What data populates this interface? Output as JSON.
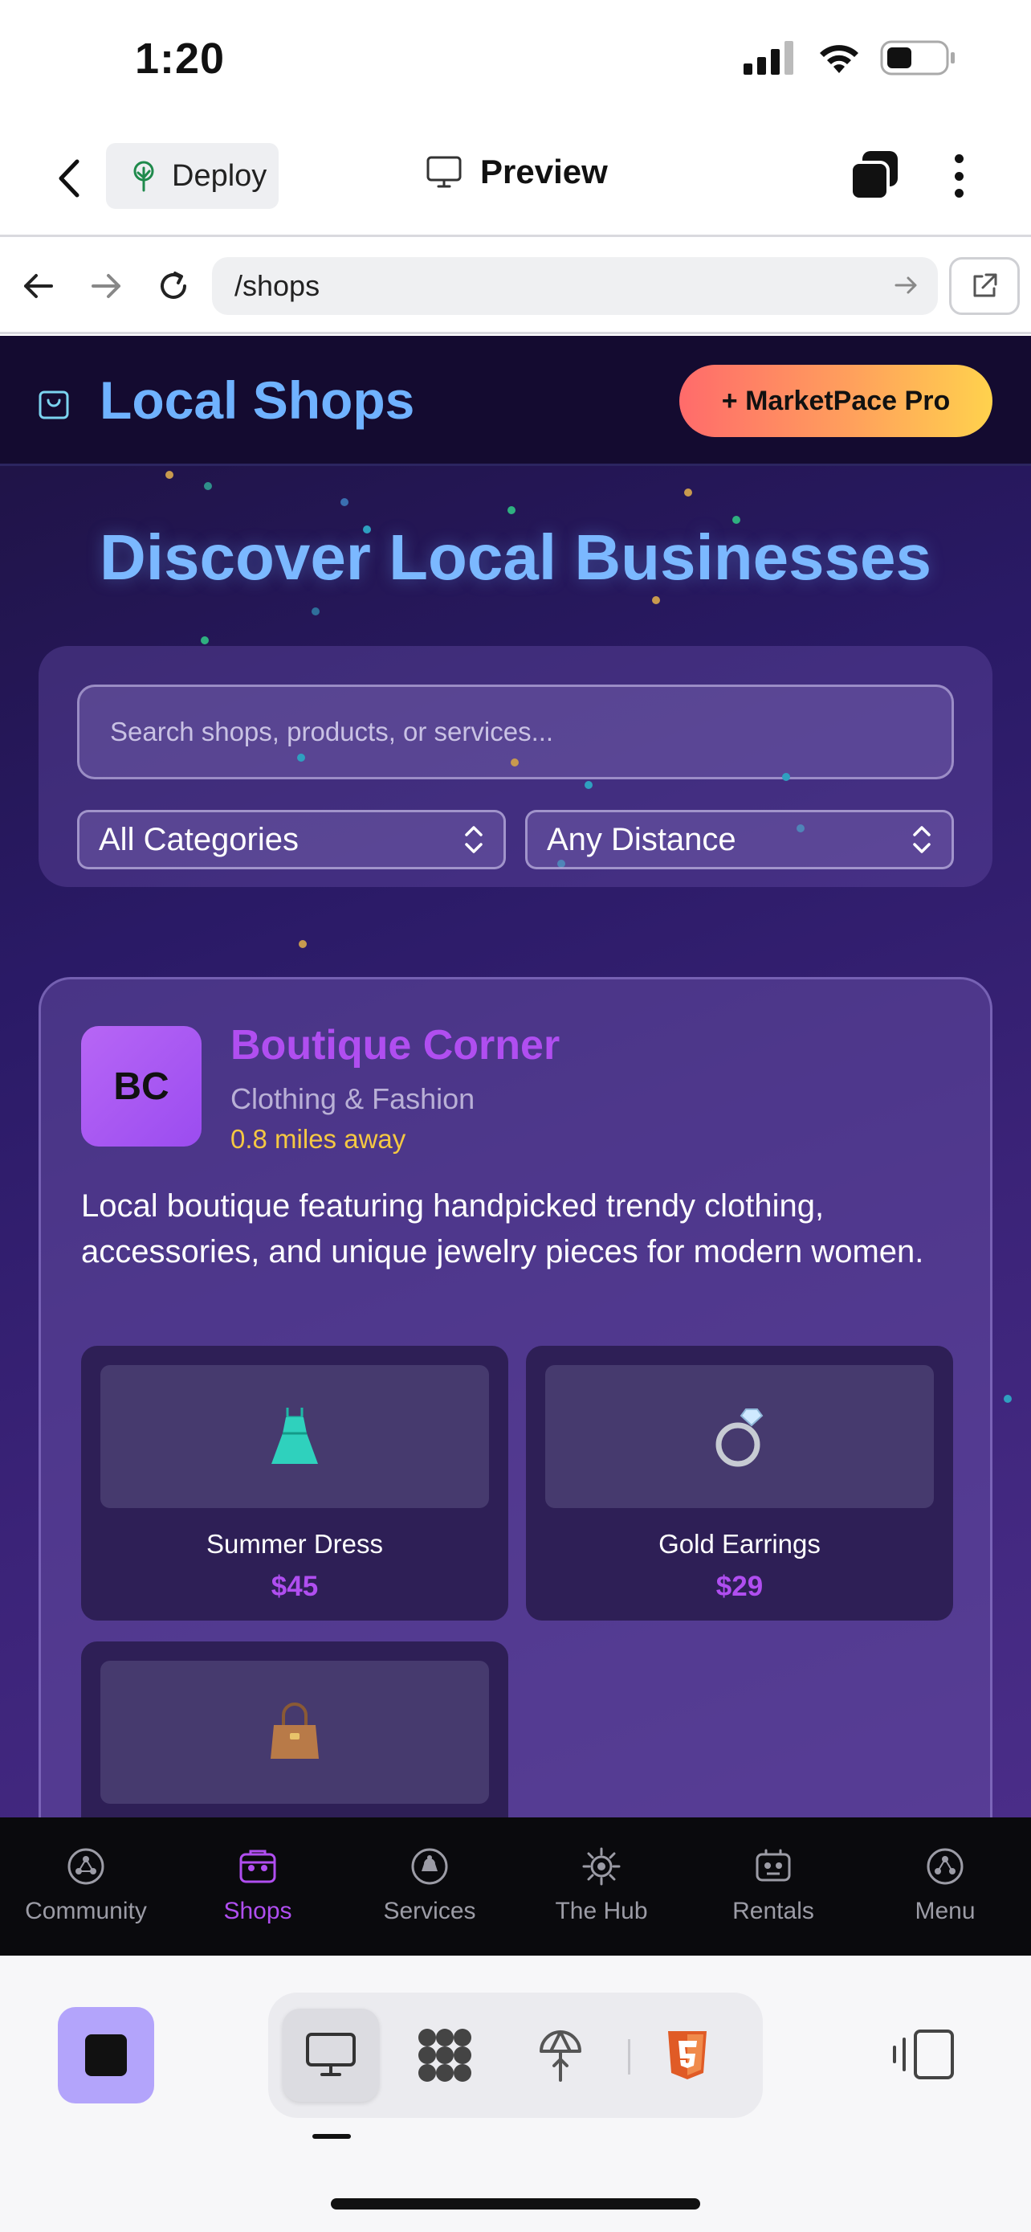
{
  "status": {
    "time": "1:20"
  },
  "appbar": {
    "deploy_label": "Deploy",
    "preview_label": "Preview"
  },
  "browser": {
    "url": "/shops"
  },
  "site": {
    "title": "Local Shops",
    "pro_button": "+ MarketPace Pro",
    "hero_title": "Discover Local Businesses",
    "search_placeholder": "Search shops, products, or services...",
    "category_select": "All Categories",
    "distance_select": "Any Distance"
  },
  "shop": {
    "initials": "BC",
    "name": "Boutique Corner",
    "category": "Clothing & Fashion",
    "distance": "0.8 miles away",
    "description": "Local boutique featuring handpicked trendy clothing, accessories, and unique jewelry pieces for modern women.",
    "products": [
      {
        "icon": "👗",
        "name": "Summer Dress",
        "price": "$45"
      },
      {
        "icon": "💍",
        "name": "Gold Earrings",
        "price": "$29"
      },
      {
        "icon": "👜",
        "name": "",
        "price": ""
      }
    ]
  },
  "tabs": [
    {
      "label": "Community",
      "icon": "community-icon"
    },
    {
      "label": "Shops",
      "icon": "shops-icon",
      "active": true
    },
    {
      "label": "Services",
      "icon": "services-icon"
    },
    {
      "label": "The Hub",
      "icon": "hub-icon"
    },
    {
      "label": "Rentals",
      "icon": "rentals-icon"
    },
    {
      "label": "Menu",
      "icon": "menu-icon"
    }
  ],
  "colors": {
    "accent_purple": "#b04ef0",
    "title_blue": "#6fb2ff",
    "distance_yellow": "#f5c842",
    "stop_button": "#b3a4fb"
  }
}
